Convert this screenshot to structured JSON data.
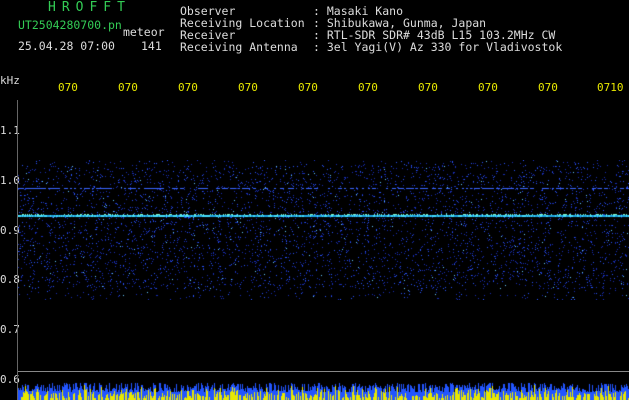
{
  "header": {
    "app_title": "HROFFT",
    "file_name": "UT2504280700.pn",
    "mode": "meteor",
    "date_time": "25.04.28 07:00",
    "count": "141"
  },
  "info": [
    {
      "label": "Observer",
      "value": ": Masaki Kano"
    },
    {
      "label": "Receiving Location",
      "value": ": Shibukawa, Gunma, Japan"
    },
    {
      "label": "Receiver",
      "value": ": RTL-SDR SDR# 43dB L15 103.2MHz CW"
    },
    {
      "label": "Receiving Antenna",
      "value": ": 3el Yagi(V) Az 330 for Vladivostok"
    }
  ],
  "axis": {
    "unit": "kHz",
    "y_ticks": [
      "1.1",
      "1.0",
      "0.9",
      "0.8",
      "0.7",
      "0.6"
    ],
    "x_ticks": [
      "070",
      "070",
      "070",
      "070",
      "070",
      "070",
      "070",
      "070",
      "070",
      "0710"
    ]
  },
  "colors": {
    "background": "#000000",
    "title_green": "#33cc55",
    "tick_yellow": "#e8e800",
    "text_white": "#dcdcdc",
    "noise_blue": "#2244ff",
    "carrier_cyan": "#44e0ff"
  }
}
